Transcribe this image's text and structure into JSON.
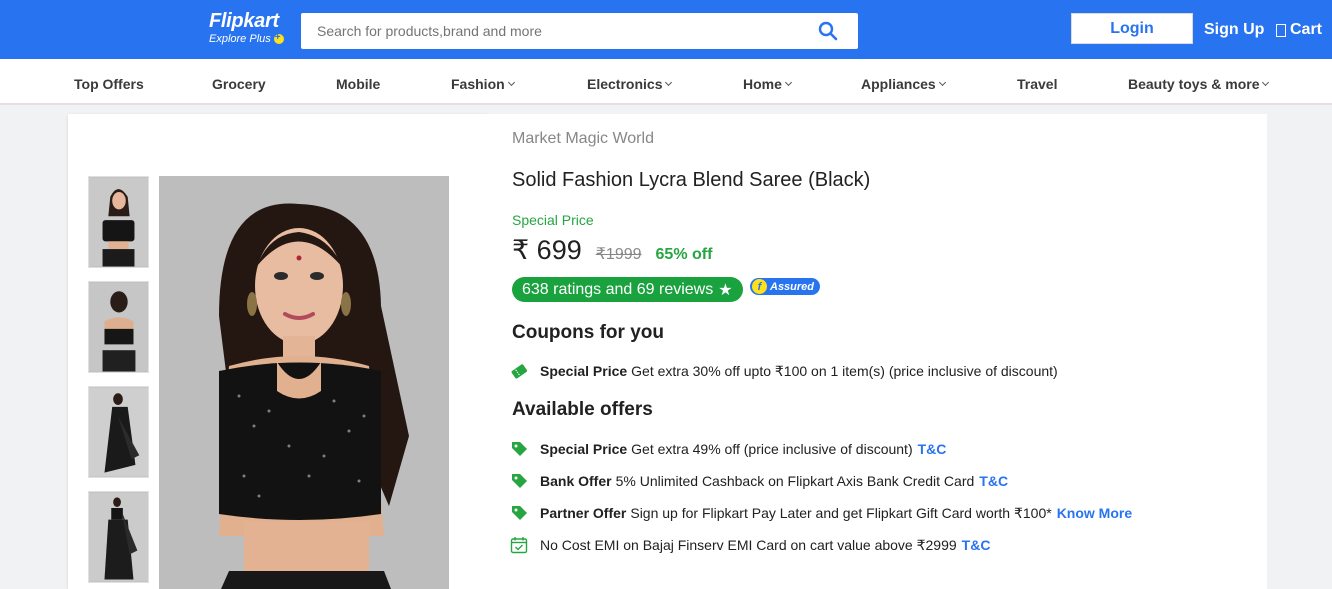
{
  "header": {
    "logo_text": "Flipkart",
    "logo_sub": "Explore Plus",
    "search_placeholder": "Search for products,brand and more",
    "login_label": "Login",
    "signup_label": "Sign Up",
    "cart_label": "Cart",
    "brand_color": "#2874f0"
  },
  "categories": [
    {
      "label": "Top Offers",
      "has_dropdown": false
    },
    {
      "label": "Grocery",
      "has_dropdown": false
    },
    {
      "label": "Mobile",
      "has_dropdown": false
    },
    {
      "label": "Fashion",
      "has_dropdown": true
    },
    {
      "label": "Electronics",
      "has_dropdown": true
    },
    {
      "label": "Home",
      "has_dropdown": true
    },
    {
      "label": "Appliances",
      "has_dropdown": true
    },
    {
      "label": "Travel",
      "has_dropdown": false
    },
    {
      "label": "Beauty toys & more",
      "has_dropdown": true
    }
  ],
  "product": {
    "seller": "Market Magic World",
    "title": "Solid Fashion Lycra Blend Saree (Black)",
    "special_price_label": "Special Price",
    "price": "₹ 699",
    "mrp": "₹1999",
    "discount": "65% off",
    "rating_text": "638 ratings and 69 reviews",
    "rating_star": "★",
    "assured_label": "Assured",
    "assured_f": "f"
  },
  "coupons": {
    "heading": "Coupons for you",
    "items": [
      {
        "title": "Special Price",
        "text": "Get extra 30% off upto ₹100 on 1 item(s) (price inclusive of discount)",
        "link": ""
      }
    ]
  },
  "offers": {
    "heading": "Available offers",
    "items": [
      {
        "title": "Special Price",
        "text": "Get extra 49% off (price inclusive of discount)",
        "link": "T&C",
        "icon": "tag-icon"
      },
      {
        "title": "Bank Offer",
        "text": "5% Unlimited Cashback on Flipkart Axis Bank Credit Card",
        "link": "T&C",
        "icon": "tag-icon"
      },
      {
        "title": "Partner Offer",
        "text": "Sign up for Flipkart Pay Later and get Flipkart Gift Card worth ₹100*",
        "link": "Know More",
        "icon": "tag-icon"
      },
      {
        "title": "",
        "text": "No Cost EMI on Bajaj Finserv EMI Card on cart value above ₹2999",
        "link": "T&C",
        "icon": "calendar-icon"
      }
    ]
  },
  "colors": {
    "green": "#26a541",
    "rating_green": "#1aa23f",
    "link_blue": "#2874f0"
  }
}
